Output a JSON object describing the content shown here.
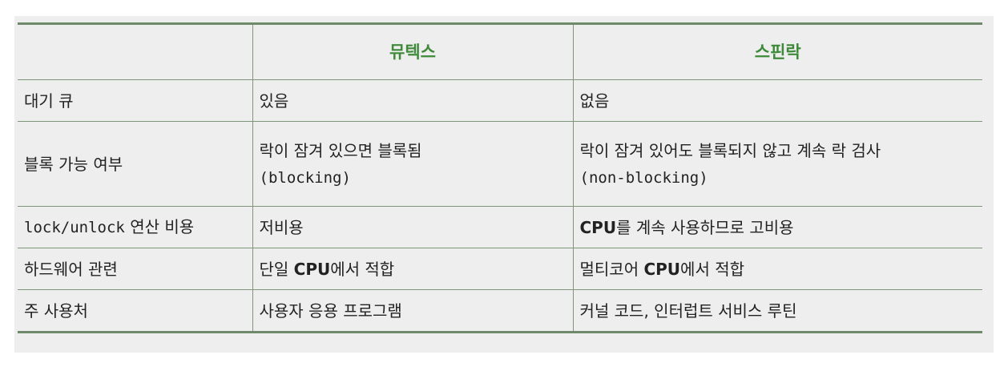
{
  "table": {
    "header": {
      "col0": "",
      "col1": "뮤텍스",
      "col2": "스핀락"
    },
    "rows": [
      {
        "label": "대기 큐",
        "mutex": "있음",
        "spin": "없음"
      },
      {
        "label": "블록 가능 여부",
        "mutex": "락이 잠겨 있으면 블록됨",
        "mutex_code": "(blocking)",
        "spin": "락이 잠겨 있어도 블록되지 않고 계속 락 검사",
        "spin_code": "(non-blocking)"
      },
      {
        "label_code": "lock/unlock",
        "label_text": " 연산 비용",
        "mutex": "저비용",
        "spin_cpu": "CPU",
        "spin_text": "를 계속 사용하므로 고비용"
      },
      {
        "label": "하드웨어 관련",
        "mutex_pre": "단일 ",
        "mutex_cpu": "CPU",
        "mutex_post": "에서 적합",
        "spin_pre": "멀티코어 ",
        "spin_cpu": "CPU",
        "spin_post": "에서 적합"
      },
      {
        "label": "주 사용처",
        "mutex": "사용자 응용 프로그램",
        "spin": "커널 코드, 인터럽트 서비스 루틴"
      }
    ]
  }
}
